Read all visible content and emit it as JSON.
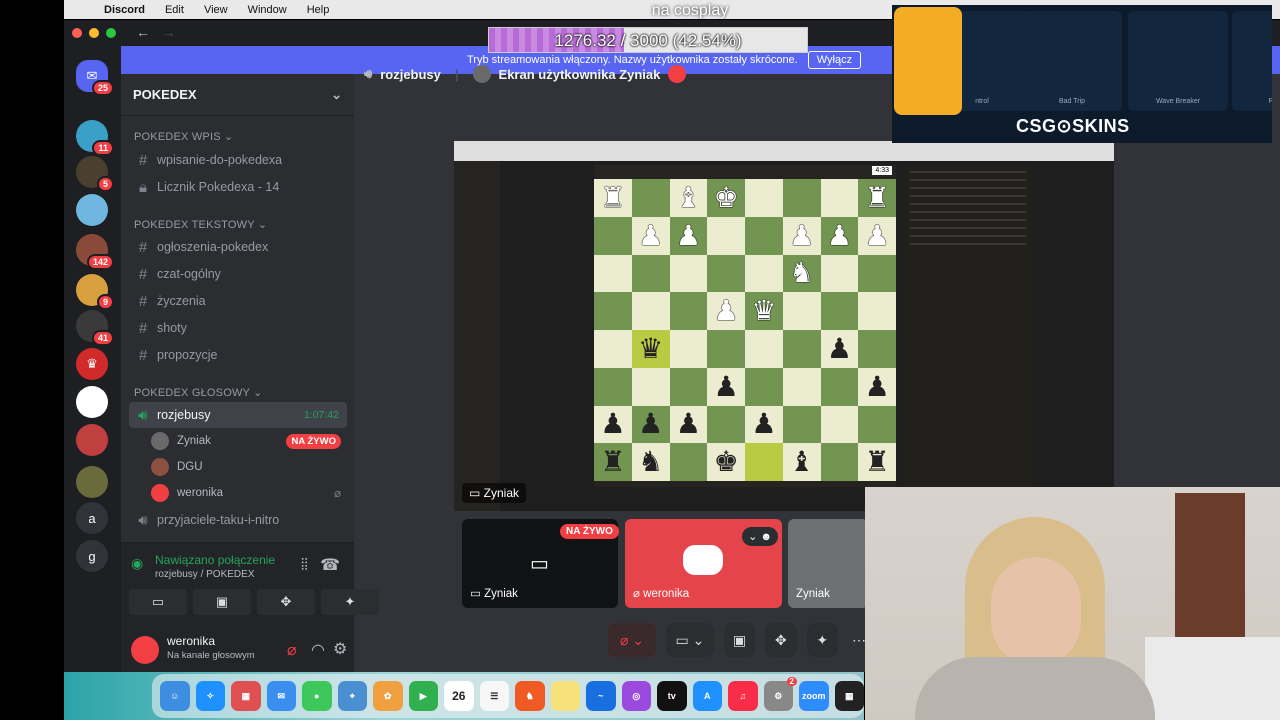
{
  "menubar": {
    "app": "Discord",
    "items": [
      "Edit",
      "View",
      "Window",
      "Help"
    ]
  },
  "overlay": {
    "title": "na cosplay",
    "progress_text": "1276.32 / 3000 (42.54%)",
    "progress_fraction": 0.4254
  },
  "notice": {
    "text": "Tryb streamowania włączony. Nazwy użytkownika zostały skrócone.",
    "button": "Wyłącz"
  },
  "guilds": [
    {
      "badge": "25",
      "color": "#5865f2",
      "glyph": "✉"
    },
    {
      "badge": "11",
      "color": "#3aa0c8",
      "glyph": ""
    },
    {
      "badge": "5",
      "color": "#4a4030",
      "glyph": ""
    },
    {
      "badge": "",
      "color": "#6fb6e0",
      "glyph": ""
    },
    {
      "badge": "142",
      "color": "#8a4a3a",
      "glyph": ""
    },
    {
      "badge": "9",
      "color": "#d9a040",
      "glyph": ""
    },
    {
      "badge": "41",
      "color": "#3a3a3a",
      "glyph": ""
    },
    {
      "badge": "",
      "color": "#d02a2a",
      "glyph": "♛"
    },
    {
      "badge": "",
      "color": "#ffffff",
      "glyph": ""
    },
    {
      "badge": "",
      "color": "#c04040",
      "glyph": ""
    },
    {
      "badge": "",
      "color": "#6a6a3a",
      "glyph": ""
    },
    {
      "badge": "",
      "color": "#313338",
      "glyph": "a"
    },
    {
      "badge": "",
      "color": "#313338",
      "glyph": "g"
    }
  ],
  "server": {
    "name": "POKEDEX",
    "categories": {
      "wpis": "POKEDEX Wpis",
      "tekstowy": "POKEDEX Tekstowy",
      "glosowy": "POKEDEX GŁOSOWY"
    },
    "wpis_channels": [
      "wpisanie-do-pokedexa",
      "Licznik Pokedexa - 14"
    ],
    "text_channels": [
      "ogłoszenia-pokedex",
      "czat-ogólny",
      "życzenia",
      "shoty",
      "propozycje"
    ],
    "voice_channel": {
      "name": "rozjebusy",
      "time": "1:07:42"
    },
    "voice_users": [
      {
        "name": "Zyniak",
        "live": "NA ŻYWO"
      },
      {
        "name": "DGU",
        "live": ""
      },
      {
        "name": "weronika",
        "live": ""
      }
    ],
    "extra_channel": "przyjaciele-taku-i-nitro"
  },
  "rtc": {
    "status": "Nawiązano połączenie",
    "sub": "rozjebusy / POKEDEX"
  },
  "user": {
    "name": "weronika",
    "status": "Na kanale głosowym"
  },
  "voice_header": {
    "channel": "rozjebusy",
    "screen": "Ekran użytkownika Zyniak"
  },
  "stream": {
    "label": "Zyniak",
    "clock": "4:33"
  },
  "tiles": {
    "live": "NA ŻYWO",
    "t1": "Zyniak",
    "t2": "weronika",
    "t3": "Zyniak"
  },
  "dock": {
    "calendar_day": "26",
    "zoom_label": "zoom",
    "badge": "2"
  },
  "sponsor": {
    "logo": "CSG⊙SKINS",
    "skins": [
      "ntrol",
      "Bad Trip",
      "Wave Breaker",
      "Pr"
    ]
  },
  "colors": {
    "blurple": "#5865f2",
    "green": "#23a55a",
    "red": "#f23f43",
    "board_light": "#ebecd0",
    "board_dark": "#739552"
  }
}
